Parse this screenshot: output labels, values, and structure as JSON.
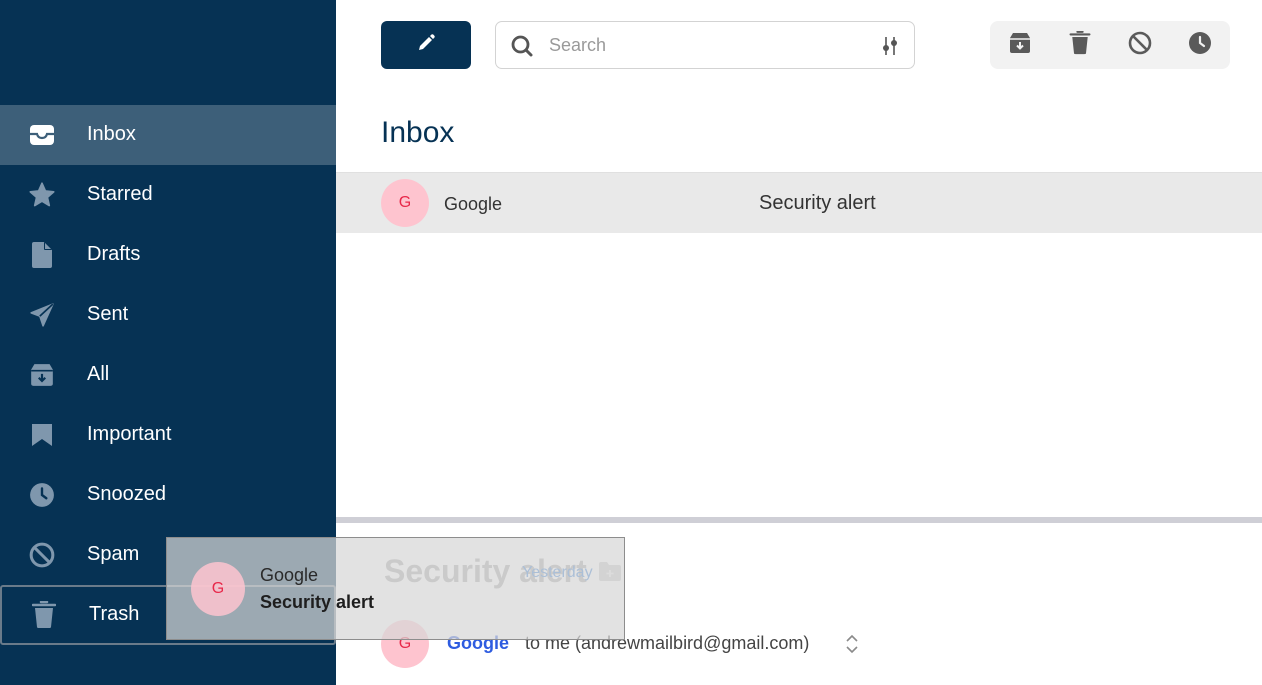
{
  "sidebar": {
    "items": [
      {
        "label": "Inbox",
        "icon": "inbox-icon",
        "active": true
      },
      {
        "label": "Starred",
        "icon": "star-icon"
      },
      {
        "label": "Drafts",
        "icon": "file-icon"
      },
      {
        "label": "Sent",
        "icon": "paper-plane-icon"
      },
      {
        "label": "All",
        "icon": "archive-icon"
      },
      {
        "label": "Important",
        "icon": "bookmark-icon"
      },
      {
        "label": "Snoozed",
        "icon": "clock-icon"
      },
      {
        "label": "Spam",
        "icon": "ban-icon"
      },
      {
        "label": "Trash",
        "icon": "trash-icon",
        "drop_target": true
      }
    ]
  },
  "toolbar": {
    "compose_icon": "pencil-icon",
    "search": {
      "placeholder": "Search",
      "value": ""
    },
    "actions": [
      {
        "name": "archive",
        "icon": "archive-icon"
      },
      {
        "name": "delete",
        "icon": "trash-icon"
      },
      {
        "name": "spam",
        "icon": "ban-icon"
      },
      {
        "name": "snooze",
        "icon": "clock-icon"
      }
    ]
  },
  "list": {
    "title": "Inbox",
    "emails": [
      {
        "avatar": "G",
        "sender": "Google",
        "subject": "Security alert",
        "selected": true
      }
    ]
  },
  "reader": {
    "subject": "Security alert",
    "date": "Yesterday",
    "avatar": "G",
    "from": "Google",
    "to": "to me (andrewmailbird@gmail.com)"
  },
  "drag_ghost": {
    "avatar": "G",
    "sender": "Google",
    "subject": "Security alert"
  },
  "colors": {
    "sidebar_bg": "#063254",
    "sidebar_active": "#3d5f79",
    "sidebar_icon": "#7f97ad",
    "avatar_bg": "#fec4cf",
    "avatar_text": "#e8284a",
    "link_blue": "#2e5ce0"
  }
}
